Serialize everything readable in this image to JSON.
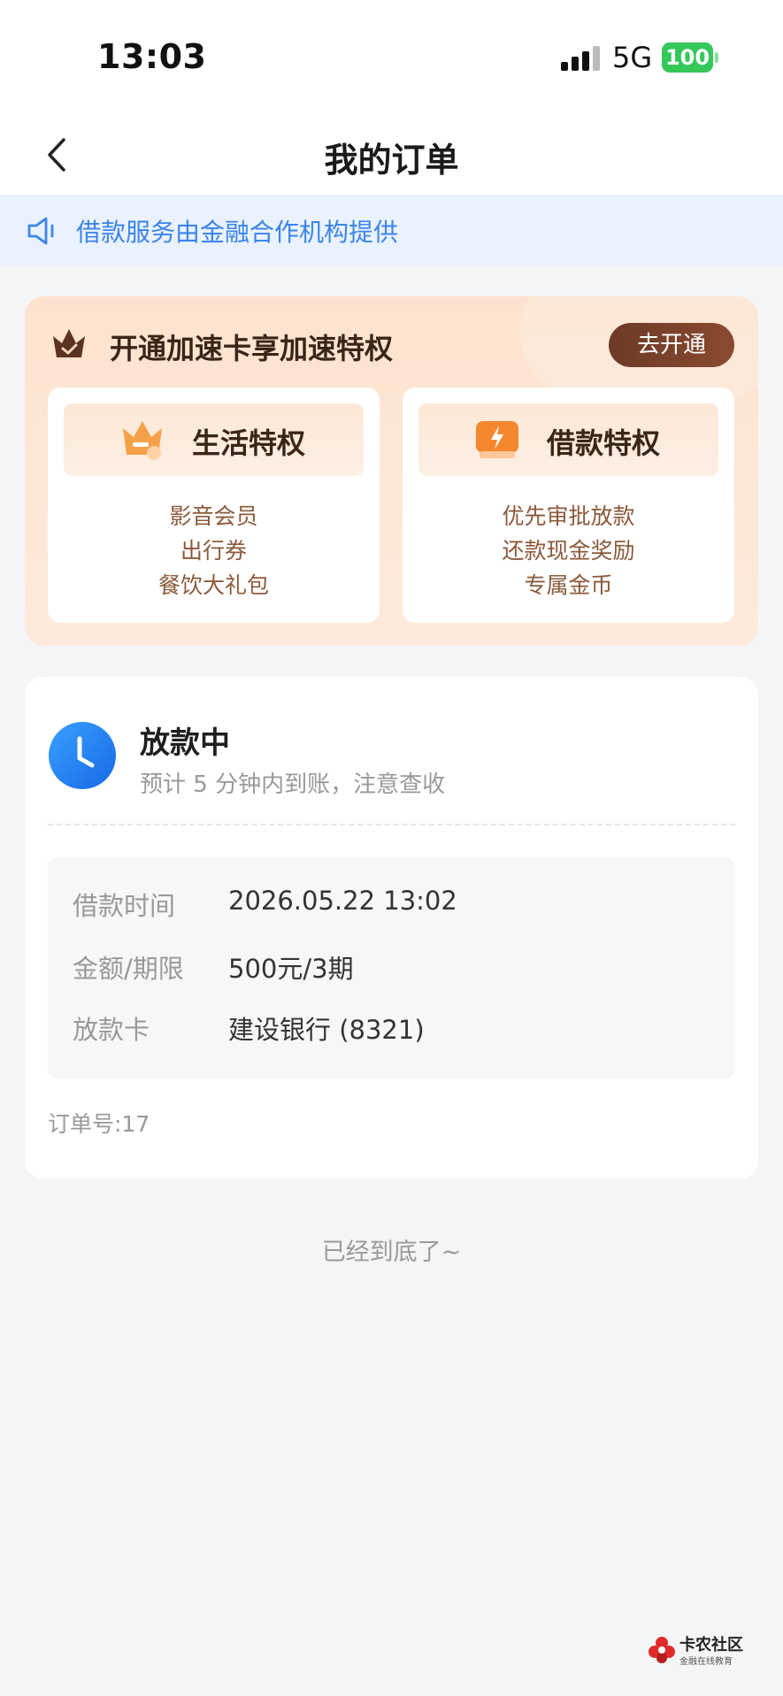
{
  "status_bar": {
    "time": "13:03",
    "network": "5G",
    "battery": "100"
  },
  "nav": {
    "title": "我的订单"
  },
  "notice": {
    "text": "借款服务由金融合作机构提供"
  },
  "vip": {
    "title": "开通加速卡享加速特权",
    "open_button": "去开通",
    "cards": [
      {
        "name": "生活特权",
        "lines": [
          "影音会员",
          "出行券",
          "餐饮大礼包"
        ]
      },
      {
        "name": "借款特权",
        "lines": [
          "优先审批放款",
          "还款现金奖励",
          "专属金币"
        ]
      }
    ]
  },
  "order": {
    "status": "放款中",
    "status_sub": "预计 5 分钟内到账，注意查收",
    "rows": [
      {
        "label": "借款时间",
        "value": "2026.05.22 13:02"
      },
      {
        "label": "金额/期限",
        "value": "500元/3期"
      },
      {
        "label": "放款卡",
        "value": "建设银行 (8321)"
      }
    ],
    "order_no": "订单号:17"
  },
  "footer": {
    "end_text": "已经到底了~"
  },
  "watermark": {
    "name": "卡农社区",
    "sub": "金融在线教育"
  },
  "colors": {
    "accent_blue": "#3b84ec",
    "battery_green": "#34c759",
    "vip_brown": "#6b3a26"
  }
}
